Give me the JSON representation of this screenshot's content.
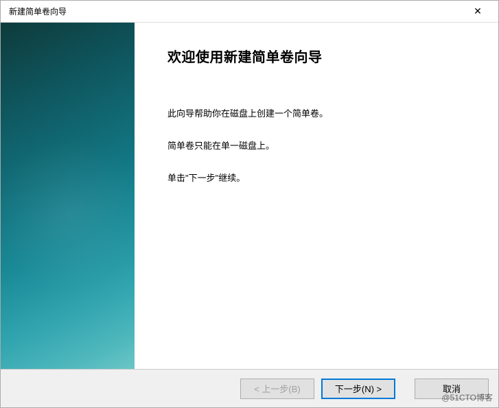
{
  "window": {
    "title": "新建简单卷向导"
  },
  "main": {
    "heading": "欢迎使用新建简单卷向导",
    "paragraph1": "此向导帮助你在磁盘上创建一个简单卷。",
    "paragraph2": "简单卷只能在单一磁盘上。",
    "paragraph3": "单击\"下一步\"继续。"
  },
  "buttons": {
    "back": "< 上一步(B)",
    "next": "下一步(N) >",
    "cancel": "取消"
  },
  "icons": {
    "close": "✕"
  },
  "watermark": "@51CTO博客"
}
